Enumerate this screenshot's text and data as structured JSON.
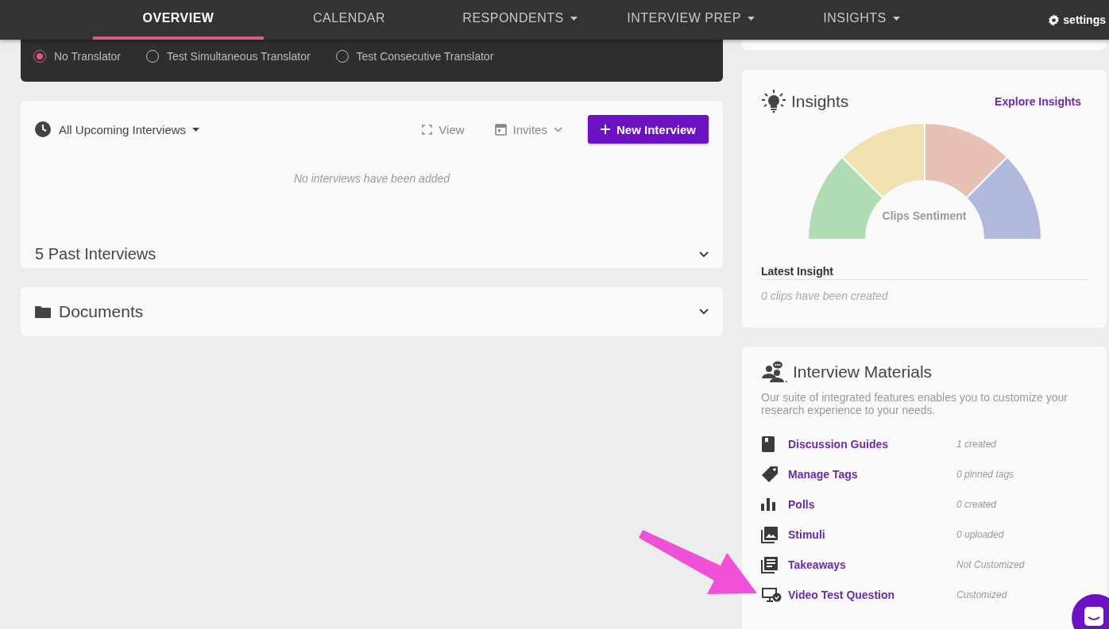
{
  "nav": {
    "tabs": [
      {
        "label": "OVERVIEW",
        "selected": true,
        "dropdown": false
      },
      {
        "label": "CALENDAR",
        "selected": false,
        "dropdown": false
      },
      {
        "label": "RESPONDENTS",
        "selected": false,
        "dropdown": true
      },
      {
        "label": "INTERVIEW PREP",
        "selected": false,
        "dropdown": true
      },
      {
        "label": "INSIGHTS",
        "selected": false,
        "dropdown": true
      }
    ],
    "settings": "settings"
  },
  "translator": {
    "options": [
      {
        "label": "No Translator",
        "selected": true
      },
      {
        "label": "Test Simultaneous Translator",
        "selected": false
      },
      {
        "label": "Test Consecutive Translator",
        "selected": false
      }
    ]
  },
  "interviews": {
    "filter": "All Upcoming Interviews",
    "view": "View",
    "invites": "Invites",
    "new_button": "New Interview",
    "empty": "No interviews have been added",
    "past": "5 Past Interviews"
  },
  "documents": {
    "title": "Documents"
  },
  "insights": {
    "title": "Insights",
    "link": "Explore Insights",
    "gauge_label": "Clips Sentiment",
    "gauge_segments": [
      {
        "color": "#b0dcb4"
      },
      {
        "color": "#f0e2b0"
      },
      {
        "color": "#e9c0b4"
      },
      {
        "color": "#b0b8dc"
      }
    ],
    "latest_title": "Latest Insight",
    "latest_empty": "0 clips have been created"
  },
  "materials": {
    "title": "Interview Materials",
    "description": "Our suite of integrated features enables you to customize your research experience to your needs.",
    "items": [
      {
        "kind": "book",
        "label": "Discussion Guides",
        "status": "1 created"
      },
      {
        "kind": "tag",
        "label": "Manage Tags",
        "status": "0 pinned tags"
      },
      {
        "kind": "bars",
        "label": "Polls",
        "status": "0 created"
      },
      {
        "kind": "image",
        "label": "Stimuli",
        "status": "0 uploaded"
      },
      {
        "kind": "list",
        "label": "Takeaways",
        "status": "Not Customized"
      },
      {
        "kind": "monitor",
        "label": "Video Test Question",
        "status": "Customized"
      }
    ]
  }
}
